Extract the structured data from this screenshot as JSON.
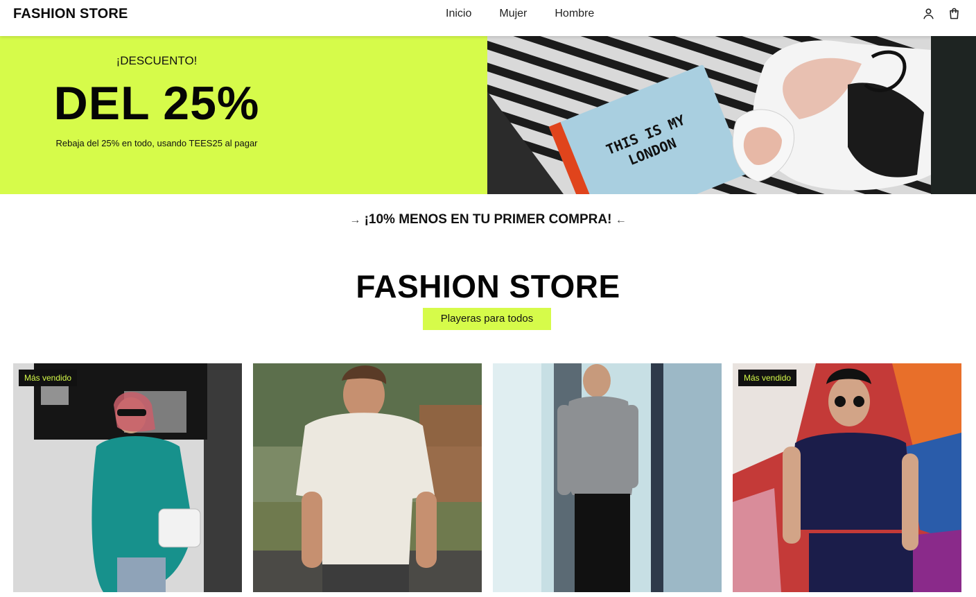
{
  "header": {
    "brand": "FASHION STORE",
    "nav": [
      "Inicio",
      "Mujer",
      "Hombre"
    ],
    "icons": [
      "user-icon",
      "cart-icon"
    ]
  },
  "hero": {
    "eyebrow": "¡DESCUENTO!",
    "headline": "DEL 25%",
    "subtext": "Rebaja del 25% en todo, usando TEES25 al pagar",
    "notebook_text_line1": "THIS IS MY",
    "notebook_text_line2": "LONDON"
  },
  "promo": {
    "arrow_left": "→",
    "text": "¡10% MENOS EN TU PRIMER COMPRA!",
    "arrow_right": "←"
  },
  "section": {
    "title": "FASHION STORE",
    "tag": "Playeras para todos"
  },
  "products": [
    {
      "badge": "Más vendido"
    },
    {
      "badge": ""
    },
    {
      "badge": ""
    },
    {
      "badge": "Más vendido"
    }
  ],
  "colors": {
    "accent": "#d6fb4a",
    "text": "#111111",
    "badge_bg": "#111111"
  }
}
